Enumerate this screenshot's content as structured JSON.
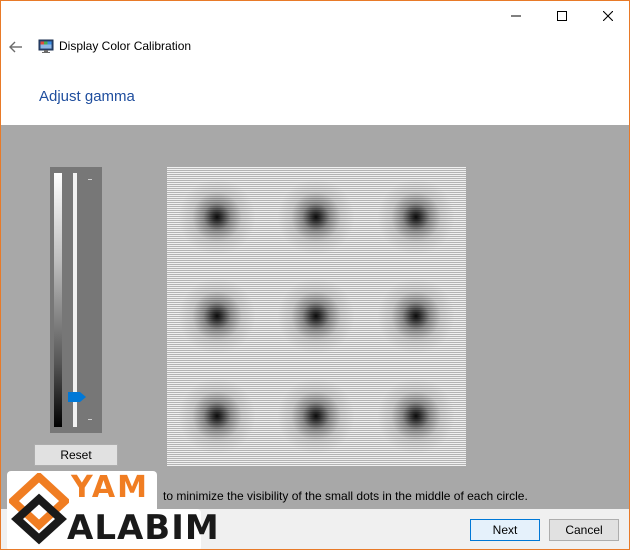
{
  "window": {
    "app_title": "Display Color Calibration",
    "controls": {
      "minimize_icon": "minimize-icon",
      "maximize_icon": "maximize-icon",
      "close_icon": "close-icon"
    },
    "back_icon": "back-arrow-icon",
    "app_icon": "display-calibration-icon"
  },
  "page": {
    "heading": "Adjust gamma",
    "instruction": "to minimize the visibility of the small dots in the middle of each circle."
  },
  "gamma_slider": {
    "level": 0.1,
    "thumb_color": "#0078d7"
  },
  "test_pattern": {
    "circles": 9
  },
  "buttons": {
    "reset": "Reset",
    "next": "Next",
    "cancel": "Cancel"
  },
  "watermark": {
    "line1": "YAM",
    "line2": "ALABIM",
    "accent_color": "#f07d22"
  },
  "colors": {
    "accent": "#0078d7",
    "heading": "#1f4e9e",
    "panel": "#a8a8a8",
    "window_border": "#e87a28"
  }
}
